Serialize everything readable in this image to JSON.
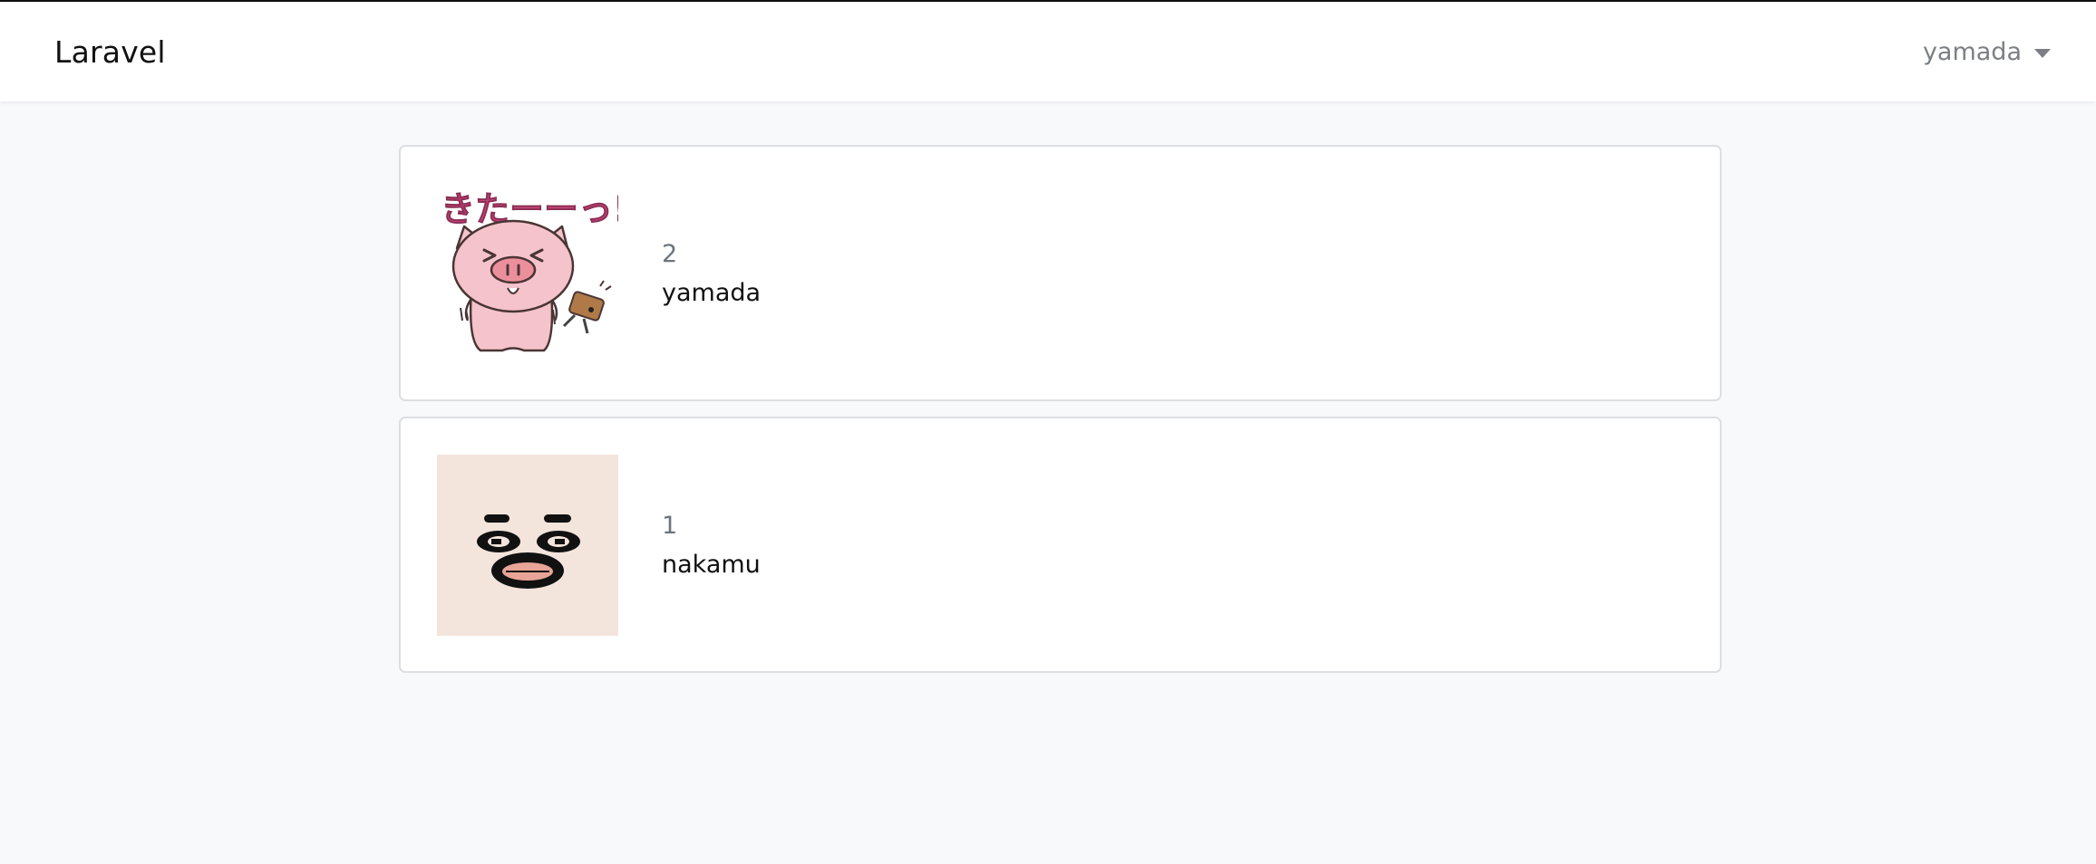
{
  "navbar": {
    "brand": "Laravel",
    "user_menu_label": "yamada"
  },
  "users": [
    {
      "id": "2",
      "name": "yamada",
      "avatar": "pig-sticker",
      "avatar_caption": "きたーーっ!!"
    },
    {
      "id": "1",
      "name": "nakamu",
      "avatar": "face-sticker"
    }
  ],
  "colors": {
    "navbar_bg": "#ffffff",
    "page_bg": "#f8f9fb",
    "face_avatar_bg": "#f3e4dc",
    "pig_pink": "#f5c3cb",
    "caption_magenta": "#c8487a"
  }
}
